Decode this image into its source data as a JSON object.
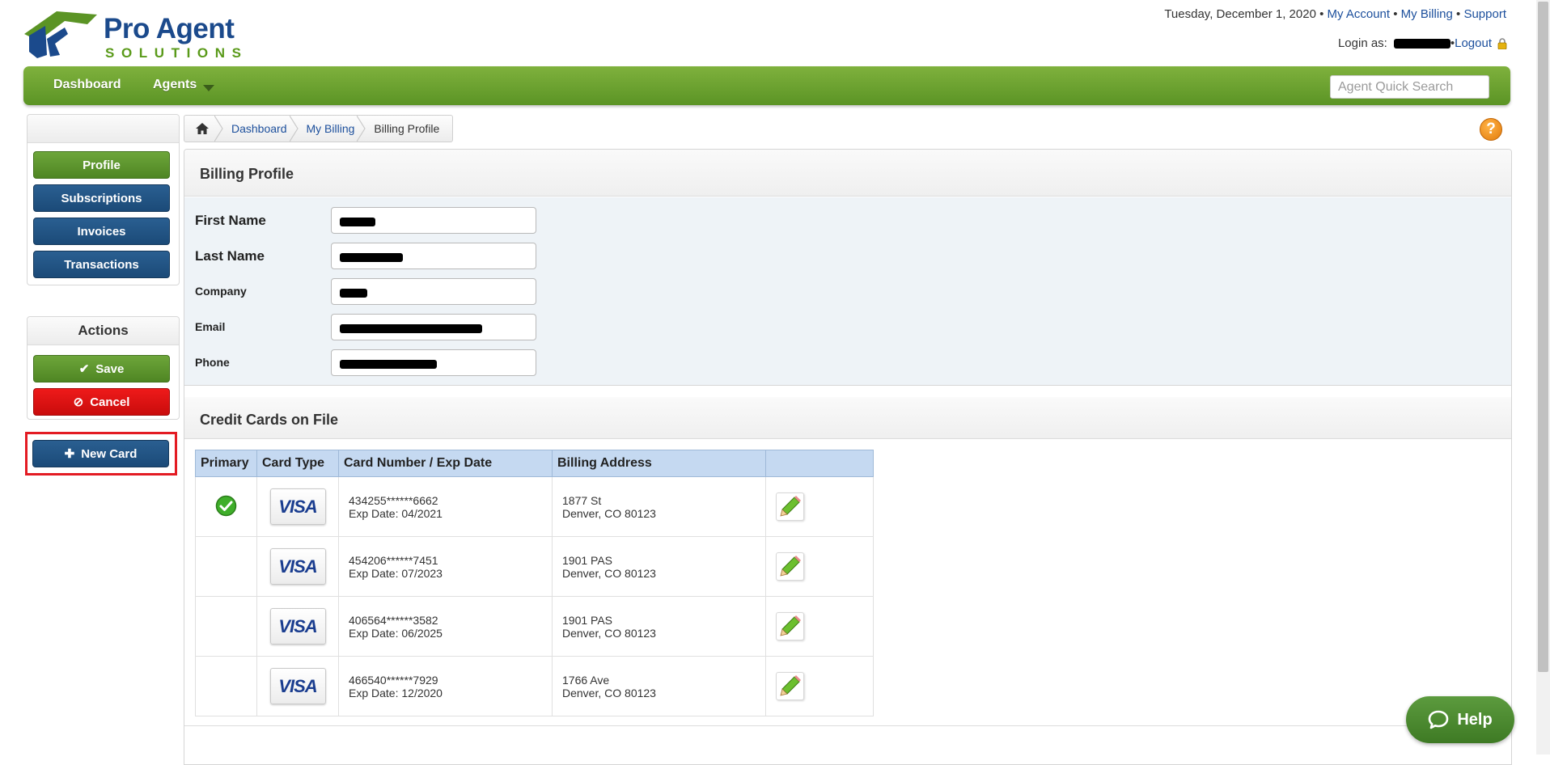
{
  "brand": {
    "name": "Pro Agent",
    "tagline": "SOLUTIONS"
  },
  "top_links": {
    "date": "Tuesday, December 1, 2020",
    "separator": " • ",
    "my_account": "My Account",
    "my_billing": "My Billing",
    "support": "Support"
  },
  "login": {
    "label": "Login as:",
    "logout": "Logout"
  },
  "nav": {
    "items": [
      {
        "label": "Dashboard"
      },
      {
        "label": "Agents"
      }
    ],
    "search_placeholder": "Agent Quick Search"
  },
  "sidebar": {
    "items": [
      {
        "label": "Profile"
      },
      {
        "label": "Subscriptions"
      },
      {
        "label": "Invoices"
      },
      {
        "label": "Transactions"
      }
    ],
    "actions_title": "Actions",
    "save_label": "Save",
    "cancel_label": "Cancel",
    "new_card_label": "New Card"
  },
  "breadcrumb": {
    "items": [
      "Dashboard",
      "My Billing",
      "Billing Profile"
    ]
  },
  "billing_profile": {
    "title": "Billing Profile",
    "fields": [
      {
        "label": "First Name"
      },
      {
        "label": "Last Name"
      },
      {
        "label": "Company"
      },
      {
        "label": "Email"
      },
      {
        "label": "Phone"
      }
    ]
  },
  "credit_cards": {
    "title": "Credit Cards on File",
    "columns": [
      "Primary",
      "Card Type",
      "Card Number / Exp Date",
      "Billing Address",
      ""
    ],
    "rows": [
      {
        "primary": true,
        "card_type": "VISA",
        "number": "434255******6662",
        "exp": "Exp Date: 04/2021",
        "address1": "1877 St",
        "address2": "Denver, CO 80123"
      },
      {
        "primary": false,
        "card_type": "VISA",
        "number": "454206******7451",
        "exp": "Exp Date: 07/2023",
        "address1": "1901 PAS",
        "address2": "Denver, CO 80123"
      },
      {
        "primary": false,
        "card_type": "VISA",
        "number": "406564******3582",
        "exp": "Exp Date: 06/2025",
        "address1": "1901 PAS",
        "address2": "Denver, CO 80123"
      },
      {
        "primary": false,
        "card_type": "VISA",
        "number": "466540******7929",
        "exp": "Exp Date: 12/2020",
        "address1": "1766 Ave",
        "address2": "Denver, CO 80123"
      }
    ]
  },
  "help_widget": {
    "label": "Help"
  },
  "help_icon": {
    "label": "?"
  },
  "icons": {
    "logo": "house-roof-logo-icon",
    "lock": "lock-icon",
    "home": "home-icon",
    "save": "checkmark-icon",
    "cancel": "prohibited-icon",
    "new": "plus-icon",
    "primary": "green-check-icon",
    "edit": "pencil-edit-icon",
    "chat": "chat-bubble-icon"
  },
  "colors": {
    "nav_green": "#6ca332",
    "brand_blue": "#1b4a8c",
    "button_blue": "#1b4a78",
    "cancel_red": "#d90f0f",
    "highlight": "#e31b23",
    "table_header": "#c5d9f1"
  }
}
